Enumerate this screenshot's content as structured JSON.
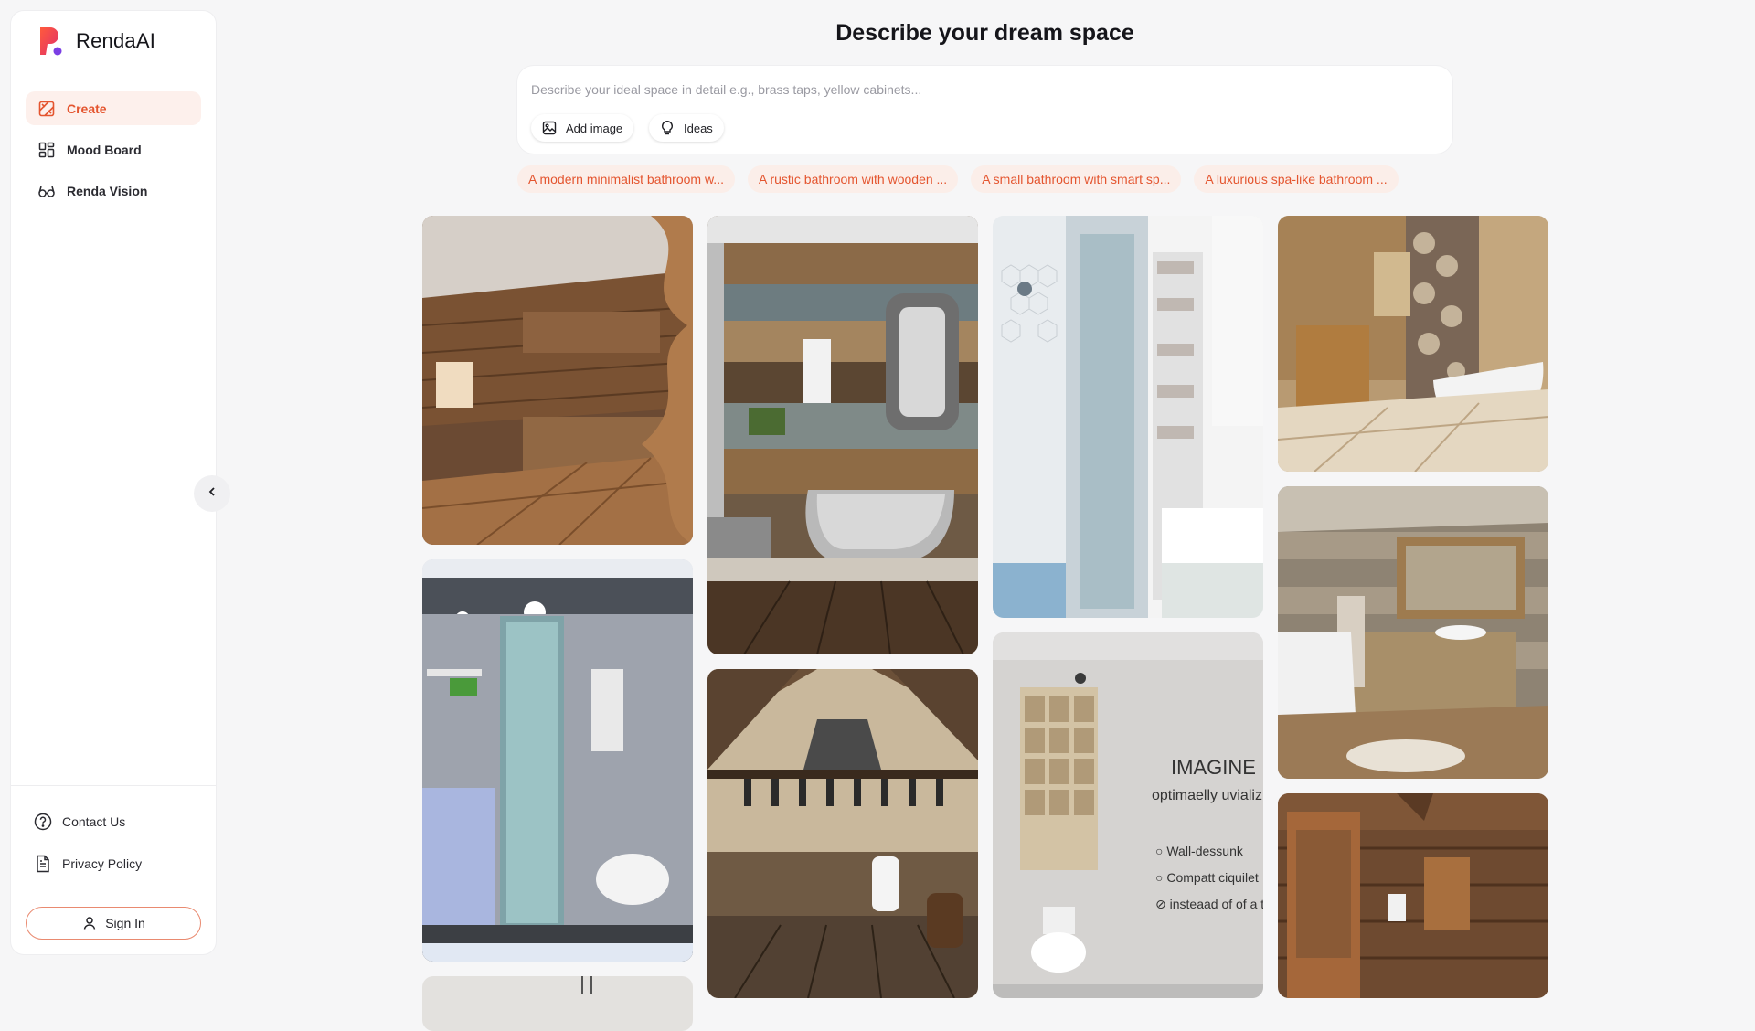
{
  "brand": {
    "name_bold": "Renda",
    "name_light": "AI"
  },
  "sidebar": {
    "items": [
      {
        "label": "Create",
        "icon": "create-icon",
        "active": true
      },
      {
        "label": "Mood Board",
        "icon": "grid-icon",
        "active": false
      },
      {
        "label": "Renda Vision",
        "icon": "glasses-icon",
        "active": false
      }
    ],
    "footer": [
      {
        "label": "Contact Us",
        "icon": "help-circle-icon"
      },
      {
        "label": "Privacy Policy",
        "icon": "document-icon"
      }
    ],
    "sign_in": "Sign In"
  },
  "main": {
    "title": "Describe your dream space",
    "prompt_placeholder": "Describe your ideal space in detail e.g., brass taps, yellow cabinets...",
    "add_image_label": "Add image",
    "ideas_label": "Ideas",
    "suggestions": [
      "A modern minimalist bathroom w...",
      "A rustic bathroom with wooden ...",
      "A small bathroom with smart sp...",
      "A luxurious spa-like bathroom ..."
    ]
  },
  "gallery": {
    "tile_3_texts": {
      "heading": "IMAGINE",
      "subheading": "optimaelly uvializ",
      "bullets": [
        "Wall-dessunk",
        "Compatt ciquilet",
        "insteaad of of a tub."
      ]
    }
  },
  "colors": {
    "accent": "#e4552f",
    "accent_bg": "#fdf0ec",
    "chip_bg": "#fbeee9",
    "page_bg": "#f6f6f7"
  }
}
